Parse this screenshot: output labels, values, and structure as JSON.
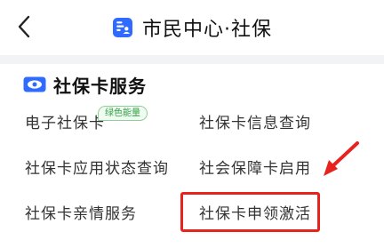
{
  "nav": {
    "title": "市民中心·社保"
  },
  "section": {
    "title": "社保卡服务",
    "badge": "绿色能量"
  },
  "items": [
    {
      "label": "电子社保卡"
    },
    {
      "label": "社保卡信息查询"
    },
    {
      "label": "社保卡应用状态查询"
    },
    {
      "label": "社会保障卡启用"
    },
    {
      "label": "社保卡亲情服务"
    },
    {
      "label": "社保卡申领激活"
    }
  ],
  "colors": {
    "accent_blue": "#2f6bff",
    "highlight_red": "#e8231f",
    "badge_green": "#2fa043"
  },
  "icons": {
    "back": "chevron-left-icon",
    "title": "id-card-icon",
    "section": "eye-card-icon",
    "annotation": "red-arrow-icon"
  }
}
